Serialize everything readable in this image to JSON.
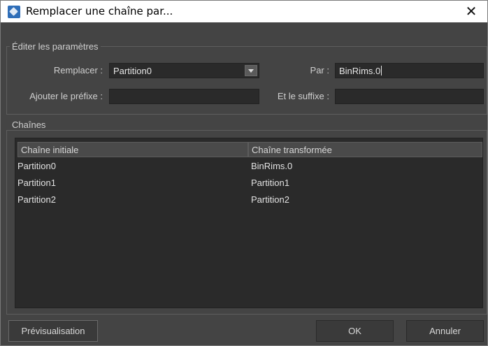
{
  "window": {
    "title": "Remplacer une chaîne par...",
    "close_glyph": "✕"
  },
  "params": {
    "group_label": "Éditer les paramètres",
    "replace_label": "Remplacer :",
    "replace_value": "Partition0",
    "by_label": "Par :",
    "by_value": "BinRims.0",
    "prefix_label": "Ajouter le préfixe :",
    "prefix_value": "",
    "suffix_label": "Et le suffixe :",
    "suffix_value": ""
  },
  "strings": {
    "group_label": "Chaînes",
    "columns": [
      "Chaîne initiale",
      "Chaîne transformée"
    ],
    "rows": [
      [
        "Partition0",
        "BinRims.0"
      ],
      [
        "Partition1",
        "Partition1"
      ],
      [
        "Partition2",
        "Partition2"
      ]
    ]
  },
  "buttons": {
    "preview": "Prévisualisation",
    "ok": "OK",
    "cancel": "Annuler"
  },
  "icons": {
    "app": "app-icon",
    "close": "close-icon",
    "dropdown": "dropdown-arrow-icon"
  }
}
